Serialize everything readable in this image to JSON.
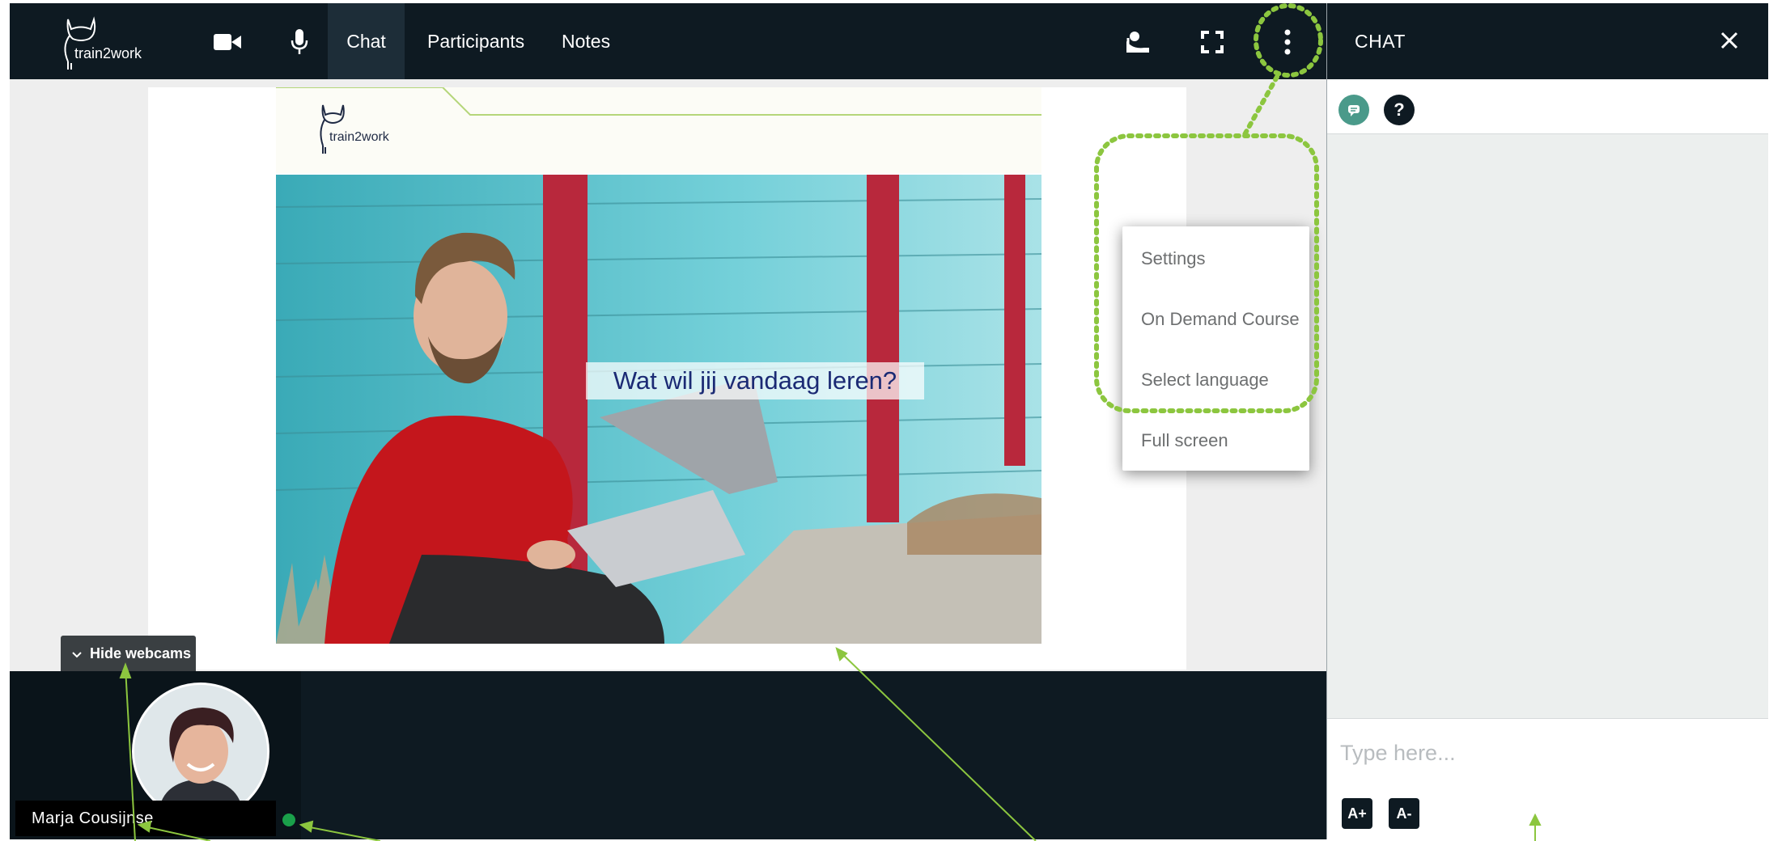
{
  "header": {
    "logo_text": "train2work",
    "tabs": [
      {
        "label": "Chat",
        "active": true
      },
      {
        "label": "Participants",
        "active": false
      },
      {
        "label": "Notes",
        "active": false
      }
    ],
    "icons": [
      "video-camera-icon",
      "microphone-icon",
      "presenter-icon",
      "fullscreen-icon",
      "more-vertical-icon"
    ]
  },
  "chat": {
    "title": "CHAT",
    "input_placeholder": "Type here...",
    "font_increase_label": "A+",
    "font_decrease_label": "A-",
    "help_label": "?"
  },
  "menu": {
    "items": [
      "Settings",
      "On Demand Course",
      "Select language",
      "Full screen"
    ]
  },
  "slide": {
    "logo_text": "train2work",
    "caption": "Wat wil jij vandaag leren?"
  },
  "webcams": {
    "toggle_label": "Hide webcams",
    "participant_name": "Marja Cousijnse"
  },
  "colors": {
    "topbar": "#0e1a22",
    "accent_green": "#8cc63f",
    "chat_icon": "#4a9a8a",
    "status_online": "#1aa04a",
    "caption_text": "#1b2a74"
  }
}
